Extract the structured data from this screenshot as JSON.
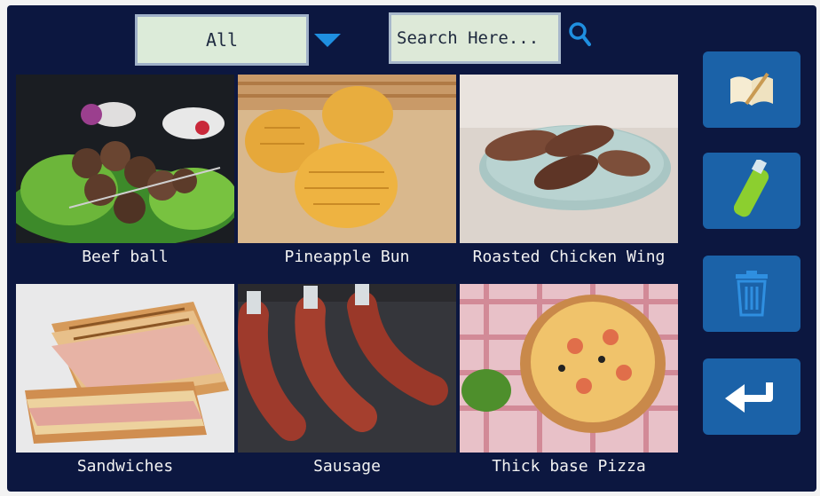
{
  "filter": {
    "selected": "All"
  },
  "search": {
    "placeholder": "Search Here..."
  },
  "menu_items": [
    {
      "label": "Beef ball"
    },
    {
      "label": "Pineapple Bun"
    },
    {
      "label": "Roasted Chicken Wing"
    },
    {
      "label": "Sandwiches"
    },
    {
      "label": "Sausage"
    },
    {
      "label": "Thick base Pizza"
    }
  ],
  "side_buttons": [
    {
      "icon": "book-icon"
    },
    {
      "icon": "usb-drive-icon"
    },
    {
      "icon": "trash-icon"
    },
    {
      "icon": "back-arrow-icon"
    }
  ],
  "colors": {
    "screen_bg": "#0c1740",
    "button_bg": "#1b62a8",
    "accent": "#1f8fe0"
  }
}
